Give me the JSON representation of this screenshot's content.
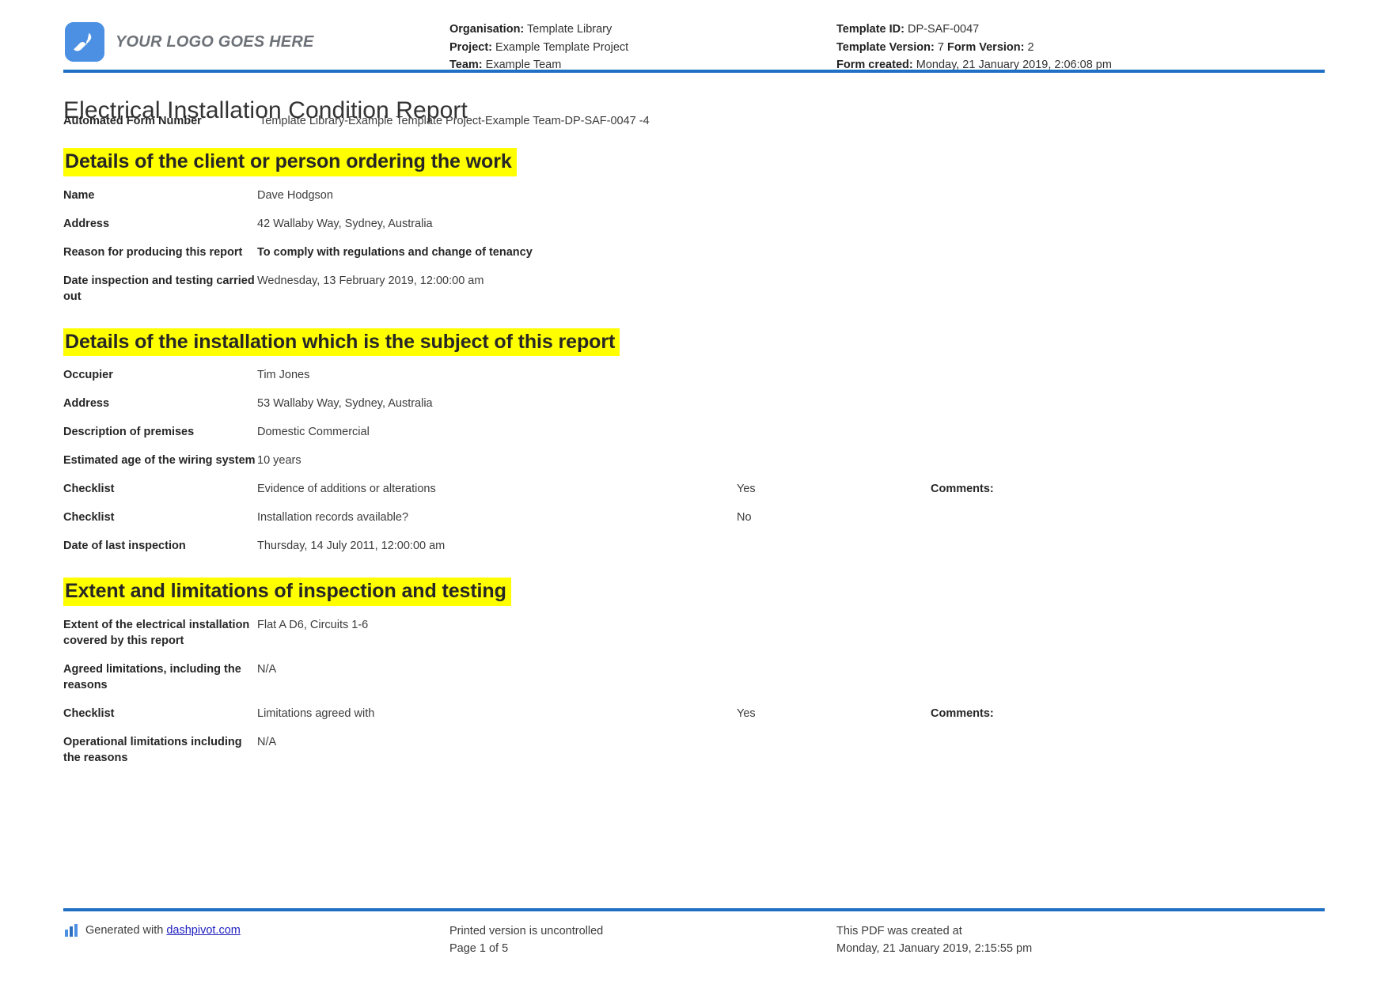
{
  "header": {
    "logo_text": "YOUR LOGO GOES HERE",
    "organisation_label": "Organisation:",
    "organisation_value": "Template Library",
    "project_label": "Project:",
    "project_value": "Example Template Project",
    "team_label": "Team:",
    "team_value": "Example Team",
    "template_id_label": "Template ID:",
    "template_id_value": "DP-SAF-0047",
    "template_version_label": "Template Version:",
    "template_version_value": "7",
    "form_version_label": "Form Version:",
    "form_version_value": "2",
    "form_created_label": "Form created:",
    "form_created_value": "Monday, 21 January 2019, 2:06:08 pm",
    "rule_color": "#1f6fc4",
    "logo_color": "#4b90e2"
  },
  "document": {
    "title": "Electrical Installation Condition Report",
    "automated_form_number_label": "Automated Form Number",
    "automated_form_number_value": "Template Library-Example Template Project-Example Team-DP-SAF-0047   -4"
  },
  "sections": [
    {
      "heading": "Details of the client or person ordering the work",
      "rows": [
        {
          "label": "Name",
          "value": "Dave Hodgson",
          "bold_value": false
        },
        {
          "label": "Address",
          "value": "42 Wallaby Way, Sydney, Australia",
          "bold_value": false
        },
        {
          "label": "Reason for producing this report",
          "value": "To comply with regulations and change of tenancy",
          "bold_value": true
        },
        {
          "label": "Date inspection and testing carried out",
          "value": "Wednesday, 13 February 2019, 12:00:00 am",
          "bold_value": false
        }
      ]
    },
    {
      "heading": "Details of the installation which is the subject of this report",
      "rows": [
        {
          "label": "Occupier",
          "value": "Tim Jones",
          "bold_value": false
        },
        {
          "label": "Address",
          "value": "53 Wallaby Way, Sydney, Australia",
          "bold_value": false
        },
        {
          "label": "Description of premises",
          "value": "Domestic   Commercial",
          "bold_value": false
        },
        {
          "label": "Estimated age of the wiring system",
          "value": "10 years",
          "bold_value": false
        },
        {
          "label": "Checklist",
          "value": "Evidence of additions or alterations",
          "bold_value": false,
          "answer": "Yes",
          "comments": "Comments:"
        },
        {
          "label": "Checklist",
          "value": "Installation records available?",
          "bold_value": false,
          "answer": "No",
          "comments": ""
        },
        {
          "label": "Date of last inspection",
          "value": "Thursday, 14 July 2011, 12:00:00 am",
          "bold_value": false
        }
      ]
    },
    {
      "heading": "Extent and limitations of inspection and testing",
      "rows": [
        {
          "label": "Extent of the electrical installation covered by this report",
          "value": "Flat A D6, Circuits 1-6",
          "bold_value": false
        },
        {
          "label": "Agreed limitations, including the reasons",
          "value": "N/A",
          "bold_value": false
        },
        {
          "label": "Checklist",
          "value": "Limitations agreed with",
          "bold_value": false,
          "answer": "Yes",
          "comments": "Comments:"
        },
        {
          "label": "Operational limitations including the reasons",
          "value": "N/A",
          "bold_value": false
        }
      ]
    }
  ],
  "footer": {
    "generated_with": "Generated with",
    "link_text": "dashpivot.com",
    "printed_notice": "Printed version is uncontrolled",
    "page_number": "Page 1 of 5",
    "pdf_created_label": "This PDF was created at",
    "pdf_created_value": "Monday, 21 January 2019, 2:15:55 pm"
  }
}
